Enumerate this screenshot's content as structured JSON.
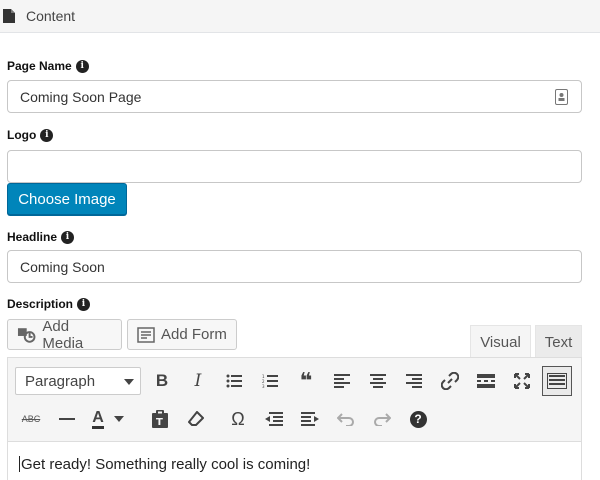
{
  "panel": {
    "title": "Content",
    "icon": "document-icon"
  },
  "fields": {
    "page_name": {
      "label": "Page Name",
      "value": "Coming Soon Page"
    },
    "logo": {
      "label": "Logo",
      "value": "",
      "button_label": "Choose Image"
    },
    "headline": {
      "label": "Headline",
      "value": "Coming Soon"
    },
    "description": {
      "label": "Description"
    }
  },
  "media_buttons": {
    "add_media": "Add Media",
    "add_form": "Add Form"
  },
  "editor_tabs": {
    "visual": "Visual",
    "text": "Text",
    "active": "visual"
  },
  "toolbar": {
    "format_value": "Paragraph",
    "row1": [
      "bold-icon",
      "italic-icon",
      "bullet-list-icon",
      "numbered-list-icon",
      "blockquote-icon",
      "align-left-icon",
      "align-center-icon",
      "align-right-icon",
      "link-icon",
      "read-more-icon",
      "fullscreen-icon",
      "toolbar-toggle-icon"
    ],
    "row2": [
      "strikethrough-icon",
      "horizontal-line-icon",
      "text-color-icon",
      "paste-text-icon",
      "clear-formatting-icon",
      "special-character-icon",
      "outdent-icon",
      "indent-icon",
      "undo-icon",
      "redo-icon",
      "help-icon"
    ],
    "bold_glyph": "B",
    "italic_glyph": "I",
    "quote_glyph": "❝",
    "omega_glyph": "Ω",
    "text_color_glyph": "A",
    "strike_glyph": "ABC",
    "help_glyph": "?"
  },
  "editor": {
    "content": "Get ready! Something really cool is coming!"
  },
  "colors": {
    "primary_button": "#0085ba",
    "background": "#ffffff",
    "toolbar": "#f5f5f5"
  }
}
